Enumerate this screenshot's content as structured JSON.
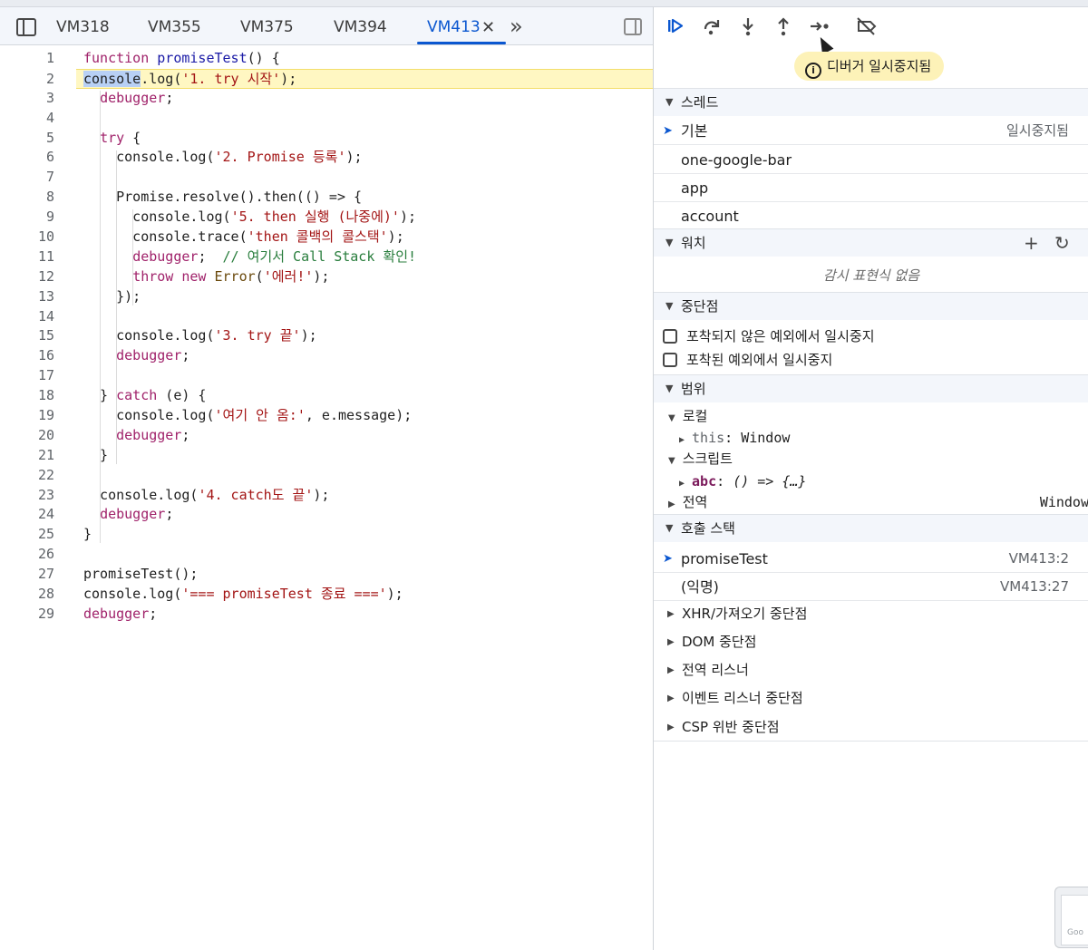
{
  "tabs": [
    {
      "label": "VM318",
      "active": false
    },
    {
      "label": "VM355",
      "active": false
    },
    {
      "label": "VM375",
      "active": false
    },
    {
      "label": "VM394",
      "active": false
    },
    {
      "label": "VM413",
      "active": true
    }
  ],
  "tab_close": "✕",
  "tab_more": "»",
  "code_lines": [
    {
      "n": "1",
      "html": "<span class='kw'>function</span> <span class='fn'>promiseTest</span>() {"
    },
    {
      "n": "2",
      "html": "<span class='hlword'>console</span>.log(<span class='str'>'1. try 시작'</span>);",
      "highlight": true
    },
    {
      "n": "3",
      "html": "  <span class='kw'>debugger</span>;"
    },
    {
      "n": "4",
      "html": ""
    },
    {
      "n": "5",
      "html": "  <span class='kw'>try</span> {"
    },
    {
      "n": "6",
      "html": "    console.log(<span class='str'>'2. Promise 등록'</span>);"
    },
    {
      "n": "7",
      "html": ""
    },
    {
      "n": "8",
      "html": "    Promise.resolve().then(() => {"
    },
    {
      "n": "9",
      "html": "      console.log(<span class='str'>'5. then 실행 (나중에)'</span>);"
    },
    {
      "n": "10",
      "html": "      console.trace(<span class='str'>'then 콜백의 콜스택'</span>);"
    },
    {
      "n": "11",
      "html": "      <span class='kw'>debugger</span>;  <span class='cmt'>// 여기서 Call Stack 확인!</span>"
    },
    {
      "n": "12",
      "html": "      <span class='kw'>throw</span> <span class='kw'>new</span> <span class='cls'>Error</span>(<span class='str'>'에러!'</span>);"
    },
    {
      "n": "13",
      "html": "    });"
    },
    {
      "n": "14",
      "html": ""
    },
    {
      "n": "15",
      "html": "    console.log(<span class='str'>'3. try 끝'</span>);"
    },
    {
      "n": "16",
      "html": "    <span class='kw'>debugger</span>;"
    },
    {
      "n": "17",
      "html": ""
    },
    {
      "n": "18",
      "html": "  } <span class='kw'>catch</span> (e) {"
    },
    {
      "n": "19",
      "html": "    console.log(<span class='str'>'여기 안 옴:'</span>, e.message);"
    },
    {
      "n": "20",
      "html": "    <span class='kw'>debugger</span>;"
    },
    {
      "n": "21",
      "html": "  }"
    },
    {
      "n": "22",
      "html": ""
    },
    {
      "n": "23",
      "html": "  console.log(<span class='str'>'4. catch도 끝'</span>);"
    },
    {
      "n": "24",
      "html": "  <span class='kw'>debugger</span>;"
    },
    {
      "n": "25",
      "html": "}"
    },
    {
      "n": "26",
      "html": ""
    },
    {
      "n": "27",
      "html": "promiseTest();"
    },
    {
      "n": "28",
      "html": "console.log(<span class='str'>'=== promiseTest 종료 ==='</span>);"
    },
    {
      "n": "29",
      "html": "<span class='kw'>debugger</span>;"
    }
  ],
  "toolbar": {
    "resume_icon": "resume-icon",
    "step_over_icon": "step-over-icon",
    "step_into_icon": "step-into-icon",
    "step_out_icon": "step-out-icon",
    "step_icon": "step-icon",
    "deactivate_icon": "deactivate-breakpoints-icon"
  },
  "paused_banner": "디버거 일시중지됨",
  "threads": {
    "title": "스레드",
    "items": [
      {
        "label": "기본",
        "status": "일시중지됨",
        "current": true
      },
      {
        "label": "one-google-bar",
        "status": ""
      },
      {
        "label": "app",
        "status": ""
      },
      {
        "label": "account",
        "status": ""
      }
    ]
  },
  "watch": {
    "title": "워치",
    "add": "+",
    "refresh": "↻",
    "empty": "감시 표현식 없음"
  },
  "breakpoints": {
    "title": "중단점",
    "options": [
      "포착되지 않은 예외에서 일시중지",
      "포착된 예외에서 일시중지"
    ]
  },
  "scope": {
    "title": "범위",
    "local": "로컬",
    "this_key": "this",
    "this_val": "Window",
    "script": "스크립트",
    "abc_key": "abc",
    "abc_val": "() => {…}",
    "global": "전역",
    "global_val": "Window"
  },
  "call_stack": {
    "title": "호출 스택",
    "frames": [
      {
        "name": "promiseTest",
        "loc": "VM413:2",
        "current": true
      },
      {
        "name": "(익명)",
        "loc": "VM413:27",
        "current": false
      }
    ]
  },
  "collapsed_sections": [
    "XHR/가져오기 중단점",
    "DOM 중단점",
    "전역 리스너",
    "이벤트 리스너 중단점",
    "CSP 위반 중단점"
  ],
  "thumb_text": "Goo"
}
